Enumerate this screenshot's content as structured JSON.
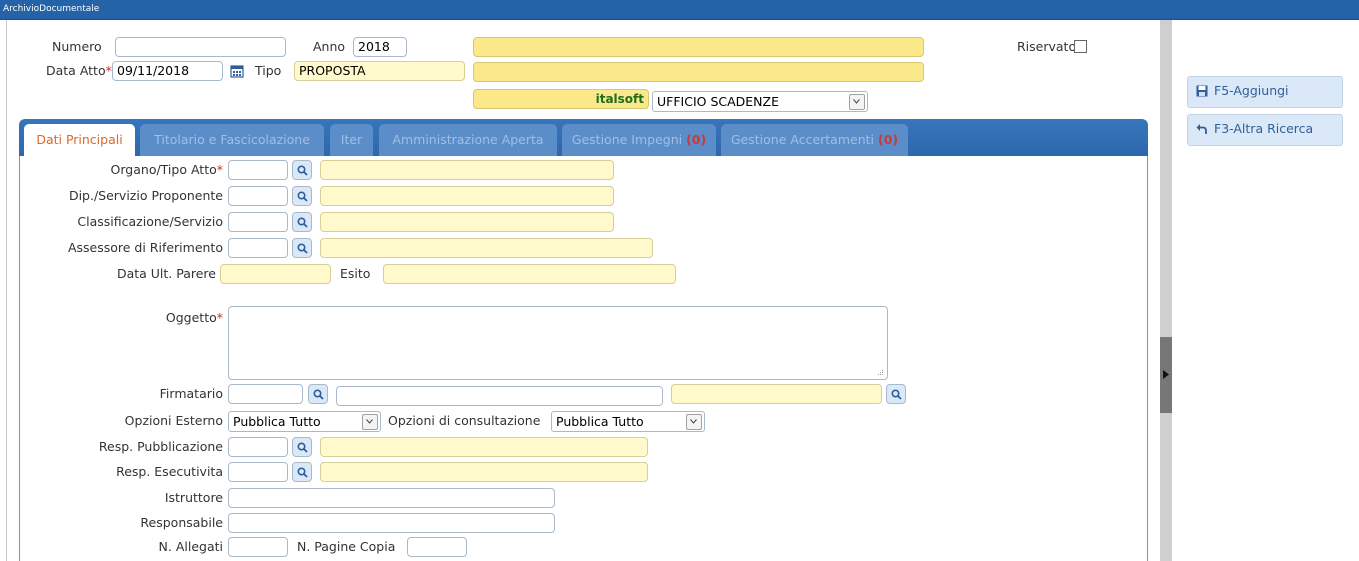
{
  "window": {
    "title": "ArchivioDocumentale"
  },
  "header": {
    "numero_label": "Numero",
    "numero_value": "",
    "anno_label": "Anno",
    "anno_value": "2018",
    "data_atto_label": "Data Atto",
    "data_atto_value": "09/11/2018",
    "tipo_label": "Tipo",
    "tipo_value": "PROPOSTA",
    "riservato_label": "Riservato",
    "riservato_checked": false,
    "ente_label": "italsoft",
    "ufficio_value": "UFFICIO SCADENZE",
    "required_mark": "*"
  },
  "tabs": [
    {
      "label": "Dati Principali",
      "active": true
    },
    {
      "label": "Titolario e Fascicolazione"
    },
    {
      "label": "Iter"
    },
    {
      "label": "Amministrazione Aperta"
    },
    {
      "label": "Gestione Impegni",
      "count": "(0)"
    },
    {
      "label": "Gestione Accertamenti",
      "count": "(0)"
    }
  ],
  "form": {
    "organo_label": "Organo/Tipo Atto",
    "dip_label": "Dip./Servizio Proponente",
    "class_label": "Classificazione/Servizio",
    "assessore_label": "Assessore di Riferimento",
    "data_parere_label": "Data Ult. Parere",
    "esito_label": "Esito",
    "oggetto_label": "Oggetto",
    "firmatario_label": "Firmatario",
    "opz_esterno_label": "Opzioni Esterno",
    "opz_esterno_value": "Pubblica Tutto",
    "opz_consult_label": "Opzioni di consultazione",
    "opz_consult_value": "Pubblica Tutto",
    "resp_pub_label": "Resp. Pubblicazione",
    "resp_esec_label": "Resp. Esecutivita",
    "istruttore_label": "Istruttore",
    "responsabile_label": "Responsabile",
    "allegati_label": "N. Allegati",
    "pagine_label": "N. Pagine Copia"
  },
  "actions": {
    "aggiungi_label": "F5-Aggiungi",
    "altra_ricerca_label": "F3-Altra Ricerca"
  },
  "colors": {
    "titlebar": "#2563a8",
    "tab_active_text": "#e0672a",
    "readonly_field": "#fff9cc",
    "highlight_field": "#fae88a"
  },
  "icons": [
    "calendar-icon",
    "search-icon",
    "chevron-down-icon",
    "save-icon",
    "back-arrow-icon",
    "collapse-arrow-icon"
  ]
}
